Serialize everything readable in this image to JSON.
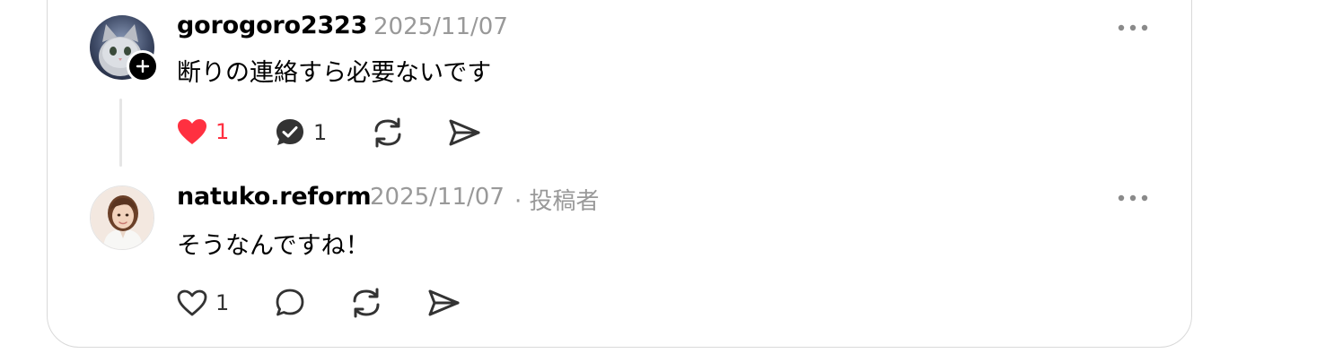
{
  "comments": [
    {
      "username": "gorogoro2323",
      "date": "2025/11/07",
      "author_tag": "",
      "text": "断りの連絡すら必要ないです",
      "like_count": "1",
      "reply_count": "1",
      "liked": true,
      "avatar_icon": "cat-avatar",
      "follow_icon": "plus-icon"
    },
    {
      "username": "natuko.reform",
      "date": "2025/11/07",
      "author_tag": "· 投稿者",
      "text": "そうなんですね！",
      "like_count": "1",
      "reply_count": "",
      "liked": false,
      "avatar_icon": "woman-avatar"
    }
  ],
  "colors": {
    "like_active": "#ff3040",
    "muted": "#999999",
    "icon": "#333333",
    "border": "#d9d9d9"
  }
}
